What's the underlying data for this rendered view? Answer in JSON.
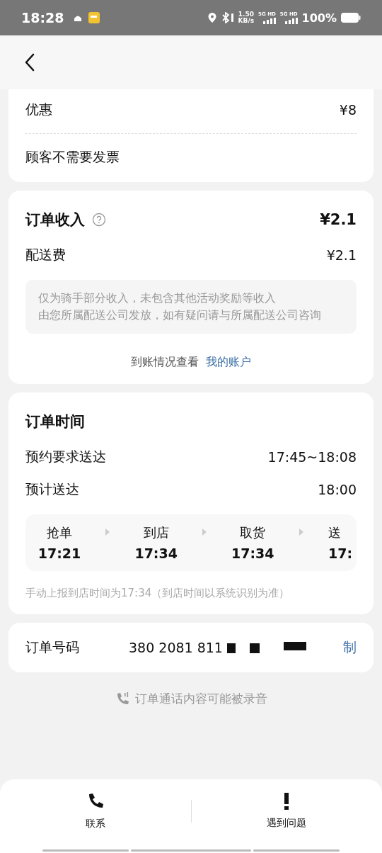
{
  "status_bar": {
    "time": "18:28",
    "speed": "1.50",
    "speed_unit": "KB/s",
    "sim": [
      "5G HD",
      "5G HD"
    ],
    "battery": "100%"
  },
  "discount_card": {
    "rows": [
      {
        "label": "优惠",
        "value": "¥8"
      }
    ],
    "invoice_note": "顾客不需要发票"
  },
  "income_card": {
    "title": "订单收入",
    "total": "¥2.1",
    "rows": [
      {
        "label": "配送费",
        "value": "¥2.1"
      }
    ],
    "notice": [
      "仅为骑手部分收入，未包含其他活动奖励等收入",
      "由您所属配送公司发放，如有疑问请与所属配送公司咨询"
    ],
    "account_prompt": "到账情况查看",
    "account_link": "我的账户"
  },
  "time_card": {
    "title": "订单时间",
    "rows": [
      {
        "label": "预约要求送达",
        "value": "17:45~18:08"
      },
      {
        "label": "预计送达",
        "value": "18:00"
      }
    ],
    "steps": [
      {
        "label": "抢单",
        "time": "17:21"
      },
      {
        "label": "到店",
        "time": "17:34"
      },
      {
        "label": "取货",
        "time": "17:34"
      },
      {
        "label": "送",
        "time": "17:"
      }
    ],
    "footnote": "手动上报到店时间为17:34（到店时间以系统识别为准）"
  },
  "order_card": {
    "label": "订单号码",
    "number": "380 2081 811",
    "copy": "制"
  },
  "recording_note": "订单通话内容可能被录音",
  "bottom_bar": [
    {
      "kind": "phone",
      "label": "联系"
    },
    {
      "kind": "alert",
      "label": "遇到问题"
    }
  ]
}
